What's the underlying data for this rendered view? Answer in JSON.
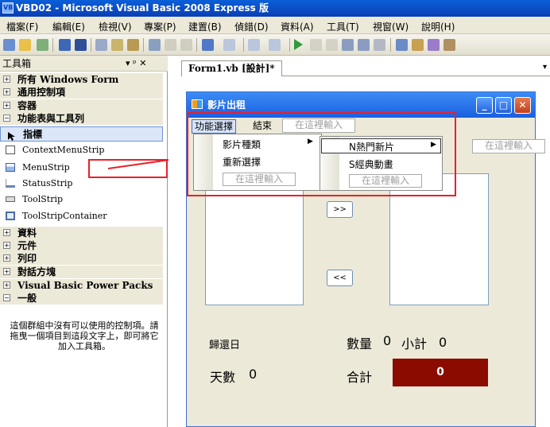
{
  "window": {
    "title": "VBD02 - Microsoft Visual Basic 2008 Express 版",
    "app_icon": "VB"
  },
  "menubar": [
    "檔案(F)",
    "編輯(E)",
    "檢視(V)",
    "專案(P)",
    "建置(B)",
    "偵錯(D)",
    "資料(A)",
    "工具(T)",
    "視窗(W)",
    "說明(H)"
  ],
  "toolbox": {
    "title": "工具箱",
    "pin": "▾ ᵖ ✕",
    "categories_top": [
      {
        "label": "所有 Windows Form",
        "state": "+"
      },
      {
        "label": "通用控制項",
        "state": "+"
      },
      {
        "label": "容器",
        "state": "+"
      },
      {
        "label": "功能表與工具列",
        "state": "−"
      }
    ],
    "items": [
      "指標",
      "ContextMenuStrip",
      "MenuStrip",
      "StatusStrip",
      "ToolStrip",
      "ToolStripContainer"
    ],
    "categories_bottom": [
      {
        "label": "資料",
        "state": "+"
      },
      {
        "label": "元件",
        "state": "+"
      },
      {
        "label": "列印",
        "state": "+"
      },
      {
        "label": "對話方塊",
        "state": "+"
      },
      {
        "label": "Visual Basic Power Packs",
        "state": "+"
      },
      {
        "label": "一般",
        "state": "−"
      }
    ],
    "note": "這個群組中沒有可以使用的控制項。請拖曳一個項目到這段文字上，即可將它加入工具箱。"
  },
  "document": {
    "tab": "Form1.vb [設計]*"
  },
  "form": {
    "title": "影片出租",
    "menu": [
      "功能選擇",
      "結束"
    ],
    "type_here": "在這裡輸入",
    "dropdown1": [
      "影片種類",
      "重新選擇"
    ],
    "dropdown2": [
      "N熱門新片",
      "S經典動畫"
    ],
    "btn_right": ">>",
    "btn_left": "<<",
    "return_label": "歸還日",
    "days_label": "天數",
    "days_value": "0",
    "qty_label": "數量",
    "qty_value": "0",
    "subtotal_label": "小計",
    "subtotal_value": "0",
    "total_label": "合計",
    "total_value": "0"
  },
  "colors": {
    "highlight": "#e8202a",
    "total_bg": "#8b0b00",
    "title_bar": "#0a4fc4"
  }
}
